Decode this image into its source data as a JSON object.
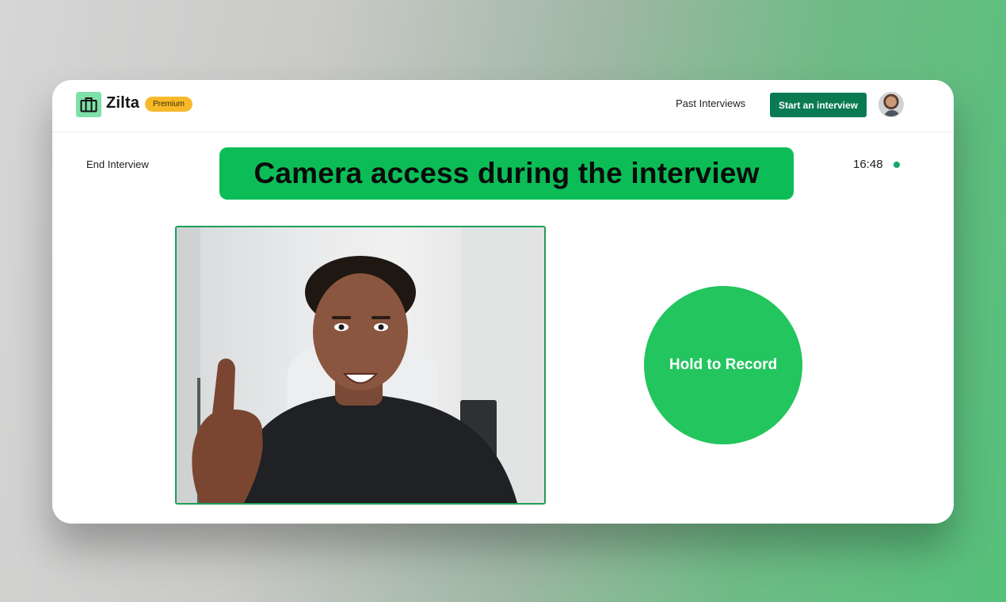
{
  "app": {
    "name": "Zilta",
    "badge": "Premium"
  },
  "nav": {
    "past_interviews": "Past Interviews",
    "start_interview": "Start an interview"
  },
  "interview": {
    "end_label": "End Interview",
    "timer": "16:48",
    "record_label": "Hold to Record"
  },
  "banner": {
    "text": "Camera access during the interview"
  },
  "icons": {
    "logo": "briefcase-icon",
    "avatar": "user-avatar",
    "status": "recording-dot"
  },
  "colors": {
    "brand_green": "#0a7a52",
    "record_green": "#22c55e",
    "banner_green": "#0cbd57",
    "premium_yellow": "#f7b92a"
  }
}
